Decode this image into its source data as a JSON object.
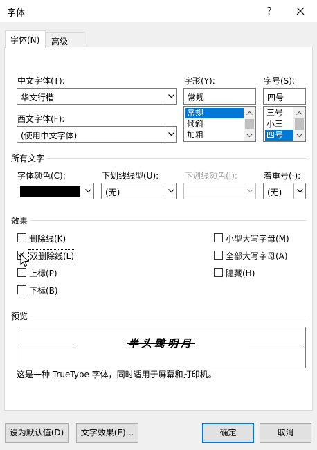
{
  "window": {
    "title": "字体",
    "help_glyph": "?",
    "close_glyph": "✕"
  },
  "tabs": [
    {
      "label": "字体(N)",
      "active": true
    },
    {
      "label": "高级(V)",
      "active": false
    }
  ],
  "font_section": {
    "chinese_font_label": "中文字体(T):",
    "chinese_font_value": "华文行楷",
    "western_font_label": "西文字体(F):",
    "western_font_value": "(使用中文字体)",
    "style_label": "字形(Y):",
    "style_value": "常规",
    "style_options": [
      "常规",
      "倾斜",
      "加粗"
    ],
    "size_label": "字号(S):",
    "size_value": "四号",
    "size_options": [
      "三号",
      "小三",
      "四号"
    ]
  },
  "all_text": {
    "section_title": "所有文字",
    "font_color_label": "字体颜色(C):",
    "font_color_value": "#000000",
    "underline_style_label": "下划线线型(U):",
    "underline_style_value": "(无)",
    "underline_color_label": "下划线颜色(I):",
    "emphasis_label": "着重号(·):",
    "emphasis_value": "(无)"
  },
  "effects": {
    "section_title": "效果",
    "items": [
      {
        "label": "删除线(K)",
        "checked": false
      },
      {
        "label": "双删除线(L)",
        "checked": true
      },
      {
        "label": "上标(P)",
        "checked": false
      },
      {
        "label": "下标(B)",
        "checked": false
      },
      {
        "label": "小型大写字母(M)",
        "checked": false
      },
      {
        "label": "全部大写字母(A)",
        "checked": false
      },
      {
        "label": "隐藏(H)",
        "checked": false
      }
    ]
  },
  "preview": {
    "section_title": "预览",
    "sample_text": "半头鹭明月",
    "description": "这是一种 TrueType 字体，同时适用于屏幕和打印机。"
  },
  "buttons": {
    "set_default": "设为默认值(D)",
    "text_effects": "文字效果(E)...",
    "ok": "确定",
    "cancel": "取消"
  },
  "colors": {
    "accent": "#0078d7",
    "selection": "#0078d7"
  }
}
